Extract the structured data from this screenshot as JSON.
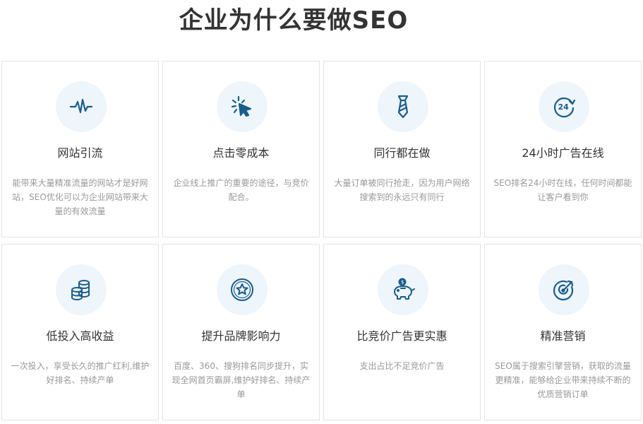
{
  "title": "企业为什么要做SEO",
  "accent_color": "#1a5d8c",
  "cards": [
    {
      "title": "网站引流",
      "desc": "能带来大量精准流量的网站才是好网站，SEO优化可以为企业网站带来大量的有效流量",
      "icon": "pulse-icon"
    },
    {
      "title": "点击零成本",
      "desc": "企业线上推广的重要的途径，与竞价配合。",
      "icon": "click-cursor-icon"
    },
    {
      "title": "同行都在做",
      "desc": "大量订单被同行抢走，因为用户网络搜索到的永远只有同行",
      "icon": "necktie-icon"
    },
    {
      "title": "24小时广告在线",
      "desc": "SEO排名24小时在线，任何时间都能让客户看到你",
      "icon": "clock-24-icon"
    },
    {
      "title": "低投入高收益",
      "desc": "一次投入，享受长久的推广红利,维护好排名、持续产单",
      "icon": "coin-stack-icon"
    },
    {
      "title": "提升品牌影响力",
      "desc": "百度、360、搜狗排名同步提升，实现全网首页霸屏,维护好排名、持续产单",
      "icon": "star-badge-icon"
    },
    {
      "title": "比竞价广告更实惠",
      "desc": "支出占比不足竞价广告",
      "icon": "piggy-bank-icon"
    },
    {
      "title": "精准营销",
      "desc": "SEO属于搜索引擎营销，获取的流量更精准，能够给企业带来持续不断的优质营销订单",
      "icon": "target-icon"
    }
  ]
}
